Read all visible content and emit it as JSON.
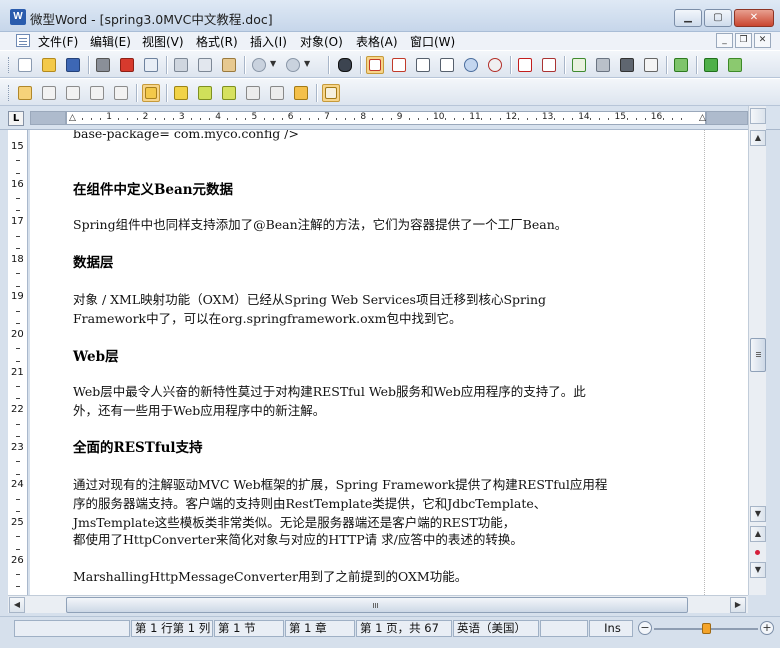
{
  "window": {
    "app_icon_letter": "W",
    "title": "微型Word - [spring3.0MVC中文教程.doc]",
    "min_glyph": "▁",
    "max_glyph": "▢",
    "close_glyph": "✕"
  },
  "menu": {
    "items": [
      "文件(F)",
      "编辑(E)",
      "视图(V)",
      "格式(R)",
      "插入(I)",
      "对象(O)",
      "表格(A)",
      "窗口(W)"
    ],
    "mdi_min": "_",
    "mdi_restore": "❐",
    "mdi_close": "✕"
  },
  "ruler": {
    "tab_selector": "L",
    "numbers": [
      "1",
      "2",
      "3",
      "4",
      "5",
      "6",
      "7",
      "8",
      "9",
      "10",
      "11",
      "12",
      "13",
      "14",
      "15",
      "16"
    ],
    "vertical_numbers": [
      "15",
      "16",
      "17",
      "18",
      "19",
      "20",
      "21",
      "22",
      "23",
      "24",
      "25",
      "26"
    ]
  },
  "document": {
    "lines": [
      {
        "kind": "p",
        "text": "   base-package= com.myco.config />"
      },
      {
        "kind": "h",
        "text": "在组件中定义Bean元数据"
      },
      {
        "kind": "p",
        "text": "Spring组件中也同样支持添加了@Bean注解的方法，它们为容器提供了一个工厂Bean。"
      },
      {
        "kind": "h",
        "text": "数据层"
      },
      {
        "kind": "p",
        "text": "对象 / XML映射功能（OXM）已经从Spring Web Services项目迁移到核心Spring"
      },
      {
        "kind": "p",
        "text": "Framework中了，可以在org.springframework.oxm包中找到它。"
      },
      {
        "kind": "h",
        "text": "Web层"
      },
      {
        "kind": "p",
        "text": "Web层中最令人兴奋的新特性莫过于对构建RESTful Web服务和Web应用程序的支持了。此"
      },
      {
        "kind": "p",
        "text": "外，还有一些用于Web应用程序中的新注解。"
      },
      {
        "kind": "h",
        "text": "全面的RESTful支持"
      },
      {
        "kind": "p",
        "text": "通过对现有的注解驱动MVC Web框架的扩展，Spring Framework提供了构建RESTful应用程"
      },
      {
        "kind": "p",
        "text": "序的服务器端支持。客户端的支持则由RestTemplate类提供，它和JdbcTemplate、"
      },
      {
        "kind": "p",
        "text": "JmsTemplate这些模板类非常类似。无论是服务器端还是客户端的REST功能，"
      },
      {
        "kind": "p",
        "text": "都使用了HttpConverter来简化对象与对应的HTTP请 求/应答中的表述的转换。"
      },
      {
        "kind": "p",
        "text": "MarshallingHttpMessageConverter用到了之前提到的OXM功能。"
      }
    ]
  },
  "scroll": {
    "up": "▲",
    "down": "▼",
    "left": "◀",
    "right": "▶",
    "prev_page": "▲",
    "next_page": "▼",
    "browse_object_color": "#d51f3a"
  },
  "status": {
    "cells": [
      "第 1 行第 1 列",
      "第 1 节",
      "第 1 章",
      "第 1 页，共 67",
      "英语（美国）",
      "",
      "Ins"
    ],
    "zoom_minus": "−",
    "zoom_plus": "+",
    "zoom_level": 0.5
  },
  "toolbar_icons": {
    "row1": [
      "new-document-icon",
      "open-folder-icon",
      "save-icon",
      "print-icon",
      "export-pdf-icon",
      "print-preview-icon",
      "cut-icon",
      "copy-icon",
      "paste-icon",
      "undo-icon",
      "redo-icon",
      "find-icon",
      "page-view-icon",
      "normal-view-icon",
      "outline-view-icon",
      "web-view-icon",
      "zoom-icon",
      "percent-icon",
      "font-color-icon",
      "text-box-icon",
      "spell-check-icon",
      "word-count-icon",
      "format-painter-icon",
      "line-icon",
      "sync-icon",
      "paragraph-mark-icon",
      "special-chars-icon"
    ],
    "row2": [
      "insert-note-icon",
      "edit-note-icon",
      "delete-note-icon",
      "prev-note-icon",
      "next-note-icon",
      "folder-icon",
      "highlight-1-icon",
      "highlight-2-icon",
      "highlight-3-icon",
      "highlight-4-icon",
      "highlight-5-icon",
      "highlight-6-icon",
      "track-changes-icon"
    ]
  }
}
